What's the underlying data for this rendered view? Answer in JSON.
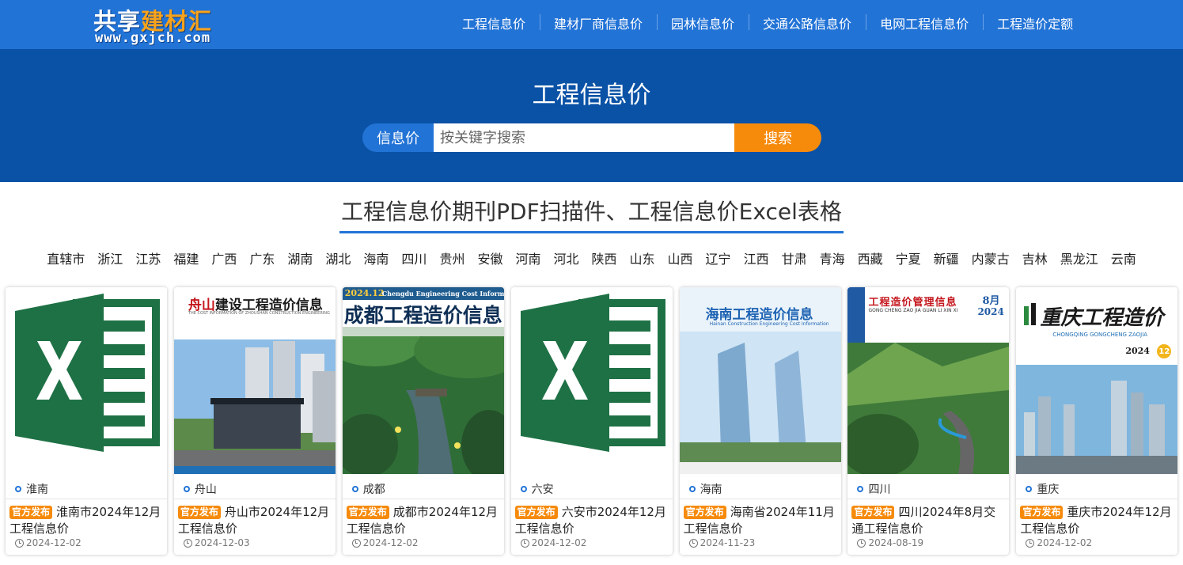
{
  "brand": {
    "logo_part1": "共享",
    "logo_part2": "建材汇",
    "url": "www.gxjch.com"
  },
  "nav": [
    "工程信息价",
    "建材厂商信息价",
    "园林信息价",
    "交通公路信息价",
    "电网工程信息价",
    "工程造价定额"
  ],
  "hero": {
    "title": "工程信息价",
    "search_label": "信息价",
    "search_placeholder": "按关键字搜索",
    "search_button": "搜索"
  },
  "section_title": "工程信息价期刊PDF扫描件、工程信息价Excel表格",
  "regions": [
    "直辖市",
    "浙江",
    "江苏",
    "福建",
    "广西",
    "广东",
    "湖南",
    "湖北",
    "海南",
    "四川",
    "贵州",
    "安徽",
    "河南",
    "河北",
    "陕西",
    "山东",
    "山西",
    "辽宁",
    "江西",
    "甘肃",
    "青海",
    "西藏",
    "宁夏",
    "新疆",
    "内蒙古",
    "吉林",
    "黑龙江",
    "云南"
  ],
  "cards": [
    {
      "city": "淮南",
      "badge": "官方发布",
      "title": "淮南市2024年12月工程信息价",
      "date": "2024-12-02",
      "cover": "excel"
    },
    {
      "city": "舟山",
      "badge": "官方发布",
      "title": "舟山市2024年12月工程信息价",
      "date": "2024-12-03",
      "cover": "zhoushan",
      "cover_title_a": "舟山",
      "cover_title_b": "建设工程造价信息",
      "cover_subtitle": "THE COST INFORMATION OF ZHOUSHAN CONSTRUCTION ENGINEERING"
    },
    {
      "city": "成都",
      "badge": "官方发布",
      "title": "成都市2024年12月工程信息价",
      "date": "2024-12-02",
      "cover": "chengdu",
      "cover_issue": "2024.12",
      "cover_en": "Chengdu Engineering Cost Information",
      "cover_title": "成都工程造价信息"
    },
    {
      "city": "六安",
      "badge": "官方发布",
      "title": "六安市2024年12月工程信息价",
      "date": "2024-12-02",
      "cover": "excel"
    },
    {
      "city": "海南",
      "badge": "官方发布",
      "title": "海南省2024年11月工程信息价",
      "date": "2024-11-23",
      "cover": "hainan",
      "cover_title": "海南工程造价信息",
      "cover_en": "Hainan Construction Engineering Cost Information"
    },
    {
      "city": "四川",
      "badge": "官方发布",
      "title": "四川2024年8月交通工程信息价",
      "date": "2024-08-19",
      "cover": "sichuan",
      "cover_title": "工程造价管理信息",
      "cover_month": "8月",
      "cover_year": "2024",
      "cover_en": "GONG CHENG ZAO JIA GUAN LI XIN XI"
    },
    {
      "city": "重庆",
      "badge": "官方发布",
      "title": "重庆市2024年12月工程信息价",
      "date": "2024-12-02",
      "cover": "chongqing",
      "cover_title": "重庆工程造价",
      "cover_en": "CHONGQING GONGCHENG ZAOJIA",
      "cover_year": "2024",
      "cover_issue": "12"
    }
  ],
  "colors": {
    "header": "#2273d6",
    "hero": "#0a52a6",
    "accent": "#f68a0b",
    "excel_green": "#1e7145"
  }
}
